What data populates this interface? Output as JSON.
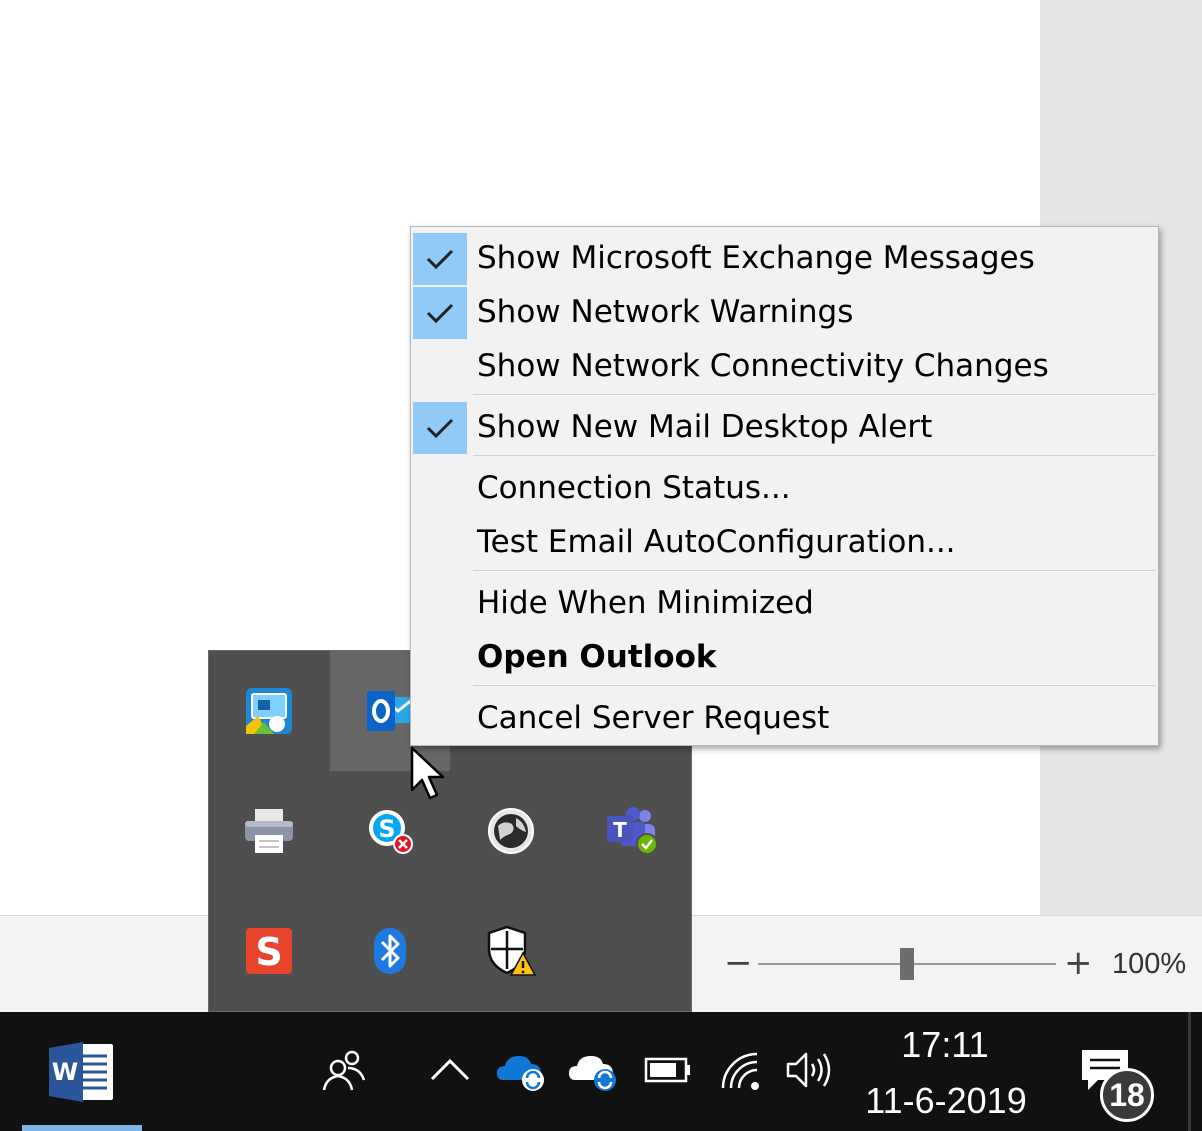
{
  "context_menu": {
    "items": [
      {
        "label": "Show Microsoft Exchange Messages",
        "checked": true
      },
      {
        "label": "Show Network Warnings",
        "checked": true
      },
      {
        "label": "Show Network Connectivity Changes",
        "checked": false
      },
      {
        "label": "Show New Mail Desktop Alert",
        "checked": true
      },
      {
        "label": "Connection Status...",
        "checked": false
      },
      {
        "label": "Test Email AutoConfiguration...",
        "checked": false
      },
      {
        "label": "Hide When Minimized",
        "checked": false
      },
      {
        "label": "Open Outlook",
        "checked": false,
        "default": true
      },
      {
        "label": "Cancel Server Request",
        "checked": false
      }
    ]
  },
  "tray_flyout": {
    "icons": [
      "intel-graphics-icon",
      "outlook-icon",
      "printer-icon",
      "skype-icon",
      "vpn-globe-icon",
      "teams-icon",
      "snagit-icon",
      "bluetooth-icon",
      "windows-security-icon"
    ]
  },
  "status_bar": {
    "zoom_minus": "−",
    "zoom_plus": "+",
    "zoom_percent": "100%",
    "zoom_level": 100
  },
  "taskbar": {
    "time": "17:11",
    "date": "11-6-2019",
    "notification_count": "18",
    "accent_color": "#7fb4e6"
  },
  "colors": {
    "menu_check_bg": "#91c9f7",
    "menu_bg": "#f2f2f2",
    "flyout_bg": "#4f4f4f",
    "taskbar_bg": "#111111"
  }
}
